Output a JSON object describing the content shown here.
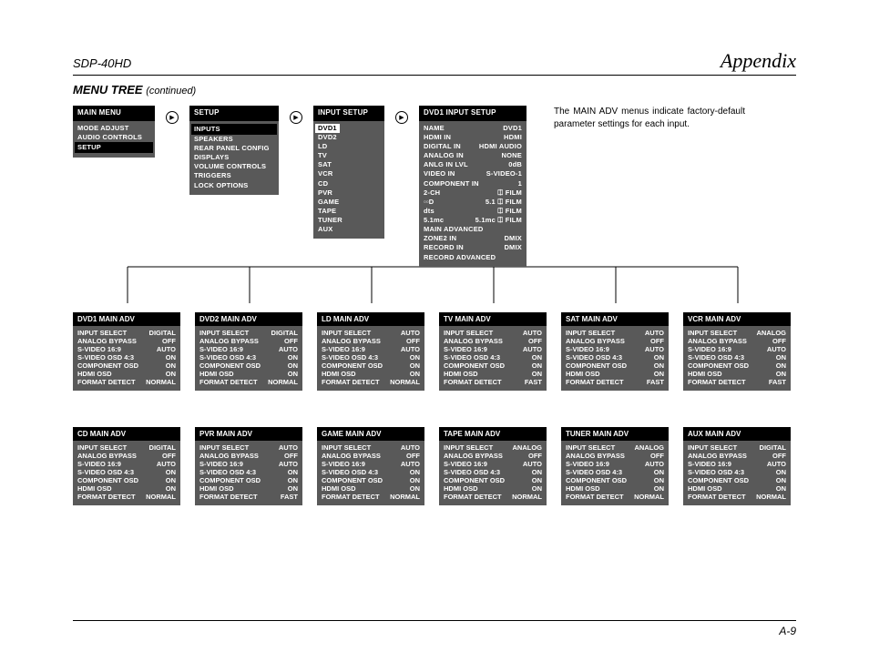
{
  "header": {
    "model": "SDP-40HD",
    "section": "Appendix"
  },
  "title": {
    "main": "MENU TREE",
    "cont": "(continued)"
  },
  "note": "The MAIN ADV menus indicate factory-default parameter settings for each input.",
  "footer": "A-9",
  "mainmenu": {
    "heading": "MAIN MENU",
    "items": [
      "MODE ADJUST",
      "AUDIO CONTROLS",
      "SETUP"
    ]
  },
  "setup": {
    "heading": "SETUP",
    "items": [
      "INPUTS",
      "SPEAKERS",
      "REAR PANEL CONFIG",
      "DISPLAYS",
      "VOLUME CONTROLS",
      "TRIGGERS",
      "LOCK OPTIONS"
    ]
  },
  "inputsetup": {
    "heading": "INPUT SETUP",
    "items": [
      "DVD1",
      "DVD2",
      "LD",
      "TV",
      "SAT",
      "VCR",
      "CD",
      "PVR",
      "GAME",
      "TAPE",
      "TUNER",
      "AUX"
    ]
  },
  "dvd1setup": {
    "heading": "DVD1 INPUT SETUP",
    "rows": [
      {
        "k": "NAME",
        "v": "DVD1"
      },
      {
        "k": "HDMI IN",
        "v": "HDMI"
      },
      {
        "k": "DIGITAL IN",
        "v": "HDMI AUDIO"
      },
      {
        "k": "ANALOG IN",
        "v": "NONE"
      },
      {
        "k": "ANLG IN LVL",
        "v": "0dB"
      },
      {
        "k": "VIDEO IN",
        "v": "S-VIDEO-1"
      },
      {
        "k": "COMPONENT IN",
        "v": "1"
      },
      {
        "k": "2-CH",
        "v": "⎅ FILM"
      },
      {
        "k": "▫▫D",
        "v": "5.1  ⎅ FILM"
      },
      {
        "k": "dts",
        "v": "⎅ FILM"
      },
      {
        "k": "5.1mc",
        "v": "5.1mc ⎅ FILM"
      },
      {
        "k": "MAIN ADVANCED",
        "v": ""
      },
      {
        "k": "ZONE2 IN",
        "v": "DMIX"
      },
      {
        "k": "RECORD IN",
        "v": "DMIX"
      },
      {
        "k": "RECORD ADVANCED",
        "v": ""
      }
    ]
  },
  "adv": [
    {
      "heading": "DVD1 MAIN ADV",
      "rows": [
        {
          "k": "INPUT SELECT",
          "v": "DIGITAL"
        },
        {
          "k": "ANALOG BYPASS",
          "v": "OFF"
        },
        {
          "k": "S-VIDEO 16:9",
          "v": "AUTO"
        },
        {
          "k": "S-VIDEO OSD 4:3",
          "v": "ON"
        },
        {
          "k": "COMPONENT OSD",
          "v": "ON"
        },
        {
          "k": "HDMI OSD",
          "v": "ON"
        },
        {
          "k": "FORMAT DETECT",
          "v": "NORMAL"
        }
      ]
    },
    {
      "heading": "DVD2 MAIN ADV",
      "rows": [
        {
          "k": "INPUT SELECT",
          "v": "DIGITAL"
        },
        {
          "k": "ANALOG BYPASS",
          "v": "OFF"
        },
        {
          "k": "S-VIDEO 16:9",
          "v": "AUTO"
        },
        {
          "k": "S-VIDEO OSD 4:3",
          "v": "ON"
        },
        {
          "k": "COMPONENT OSD",
          "v": "ON"
        },
        {
          "k": "HDMI OSD",
          "v": "ON"
        },
        {
          "k": "FORMAT DETECT",
          "v": "NORMAL"
        }
      ]
    },
    {
      "heading": "LD MAIN ADV",
      "rows": [
        {
          "k": "INPUT SELECT",
          "v": "AUTO"
        },
        {
          "k": "ANALOG BYPASS",
          "v": "OFF"
        },
        {
          "k": "S-VIDEO 16:9",
          "v": "AUTO"
        },
        {
          "k": "S-VIDEO OSD 4:3",
          "v": "ON"
        },
        {
          "k": "COMPONENT OSD",
          "v": "ON"
        },
        {
          "k": "HDMI OSD",
          "v": "ON"
        },
        {
          "k": "FORMAT DETECT",
          "v": "NORMAL"
        }
      ]
    },
    {
      "heading": "TV MAIN ADV",
      "rows": [
        {
          "k": "INPUT SELECT",
          "v": "AUTO"
        },
        {
          "k": "ANALOG BYPASS",
          "v": "OFF"
        },
        {
          "k": "S-VIDEO 16:9",
          "v": "AUTO"
        },
        {
          "k": "S-VIDEO OSD 4:3",
          "v": "ON"
        },
        {
          "k": "COMPONENT OSD",
          "v": "ON"
        },
        {
          "k": "HDMI OSD",
          "v": "ON"
        },
        {
          "k": "FORMAT DETECT",
          "v": "FAST"
        }
      ]
    },
    {
      "heading": "SAT MAIN ADV",
      "rows": [
        {
          "k": "INPUT SELECT",
          "v": "AUTO"
        },
        {
          "k": "ANALOG BYPASS",
          "v": "OFF"
        },
        {
          "k": "S-VIDEO 16:9",
          "v": "AUTO"
        },
        {
          "k": "S-VIDEO OSD 4:3",
          "v": "ON"
        },
        {
          "k": "COMPONENT OSD",
          "v": "ON"
        },
        {
          "k": "HDMI OSD",
          "v": "ON"
        },
        {
          "k": "FORMAT DETECT",
          "v": "FAST"
        }
      ]
    },
    {
      "heading": "VCR MAIN ADV",
      "rows": [
        {
          "k": "INPUT SELECT",
          "v": "ANALOG"
        },
        {
          "k": "ANALOG BYPASS",
          "v": "OFF"
        },
        {
          "k": "S-VIDEO 16:9",
          "v": "AUTO"
        },
        {
          "k": "S-VIDEO OSD 4:3",
          "v": "ON"
        },
        {
          "k": "COMPONENT OSD",
          "v": "ON"
        },
        {
          "k": "HDMI OSD",
          "v": "ON"
        },
        {
          "k": "FORMAT DETECT",
          "v": "FAST"
        }
      ]
    },
    {
      "heading": "CD MAIN ADV",
      "rows": [
        {
          "k": "INPUT SELECT",
          "v": "DIGITAL"
        },
        {
          "k": "ANALOG BYPASS",
          "v": "OFF"
        },
        {
          "k": "S-VIDEO 16:9",
          "v": "AUTO"
        },
        {
          "k": "S-VIDEO OSD 4:3",
          "v": "ON"
        },
        {
          "k": "COMPONENT OSD",
          "v": "ON"
        },
        {
          "k": "HDMI OSD",
          "v": "ON"
        },
        {
          "k": "FORMAT DETECT",
          "v": "NORMAL"
        }
      ]
    },
    {
      "heading": "PVR MAIN ADV",
      "rows": [
        {
          "k": "INPUT SELECT",
          "v": "AUTO"
        },
        {
          "k": "ANALOG BYPASS",
          "v": "OFF"
        },
        {
          "k": "S-VIDEO 16:9",
          "v": "AUTO"
        },
        {
          "k": "S-VIDEO OSD 4:3",
          "v": "ON"
        },
        {
          "k": "COMPONENT OSD",
          "v": "ON"
        },
        {
          "k": "HDMI OSD",
          "v": "ON"
        },
        {
          "k": "FORMAT DETECT",
          "v": "FAST"
        }
      ]
    },
    {
      "heading": "GAME MAIN ADV",
      "rows": [
        {
          "k": "INPUT SELECT",
          "v": "AUTO"
        },
        {
          "k": "ANALOG BYPASS",
          "v": "OFF"
        },
        {
          "k": "S-VIDEO 16:9",
          "v": "AUTO"
        },
        {
          "k": "S-VIDEO OSD 4:3",
          "v": "ON"
        },
        {
          "k": "COMPONENT OSD",
          "v": "ON"
        },
        {
          "k": "HDMI OSD",
          "v": "ON"
        },
        {
          "k": "FORMAT DETECT",
          "v": "NORMAL"
        }
      ]
    },
    {
      "heading": "TAPE MAIN ADV",
      "rows": [
        {
          "k": "INPUT SELECT",
          "v": "ANALOG"
        },
        {
          "k": "ANALOG BYPASS",
          "v": "OFF"
        },
        {
          "k": "S-VIDEO 16:9",
          "v": "AUTO"
        },
        {
          "k": "S-VIDEO OSD 4:3",
          "v": "ON"
        },
        {
          "k": "COMPONENT OSD",
          "v": "ON"
        },
        {
          "k": "HDMI OSD",
          "v": "ON"
        },
        {
          "k": "FORMAT DETECT",
          "v": "NORMAL"
        }
      ]
    },
    {
      "heading": "TUNER MAIN ADV",
      "rows": [
        {
          "k": "INPUT SELECT",
          "v": "ANALOG"
        },
        {
          "k": "ANALOG BYPASS",
          "v": "OFF"
        },
        {
          "k": "S-VIDEO 16:9",
          "v": "AUTO"
        },
        {
          "k": "S-VIDEO OSD 4:3",
          "v": "ON"
        },
        {
          "k": "COMPONENT OSD",
          "v": "ON"
        },
        {
          "k": "HDMI OSD",
          "v": "ON"
        },
        {
          "k": "FORMAT DETECT",
          "v": "NORMAL"
        }
      ]
    },
    {
      "heading": "AUX MAIN ADV",
      "rows": [
        {
          "k": "INPUT SELECT",
          "v": "DIGITAL"
        },
        {
          "k": "ANALOG BYPASS",
          "v": "OFF"
        },
        {
          "k": "S-VIDEO 16:9",
          "v": "AUTO"
        },
        {
          "k": "S-VIDEO OSD 4:3",
          "v": "ON"
        },
        {
          "k": "COMPONENT OSD",
          "v": "ON"
        },
        {
          "k": "HDMI OSD",
          "v": "ON"
        },
        {
          "k": "FORMAT DETECT",
          "v": "NORMAL"
        }
      ]
    }
  ]
}
